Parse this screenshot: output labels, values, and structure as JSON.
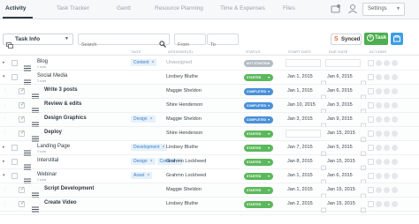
{
  "nav": {
    "tabs": [
      {
        "label": "Activity",
        "active": true
      },
      {
        "label": "Task Tracker"
      },
      {
        "label": "Gantt"
      },
      {
        "label": "Resource Planning"
      },
      {
        "label": "Time & Expenses"
      },
      {
        "label": "Files"
      }
    ],
    "settings_label": "Settings"
  },
  "toolbar": {
    "view_label": "Task Info",
    "search_placeholder": "Search",
    "from_placeholder": "From",
    "to_placeholder": "To",
    "synced_label": "Synced",
    "add_task_label": "Task"
  },
  "columns": {
    "tags": "TAGS",
    "assignee": "ASSIGNEE(S)",
    "status": "STATUS",
    "start_date": "START DATE",
    "due_date": "DUE DATE",
    "actions": "ACTIONS"
  },
  "colors": {
    "not_started": "#b4bcc4",
    "started": "#5cb85c",
    "completed": "#4a90d9",
    "tag_bg": "#e6f1fb",
    "tag_text": "#3b7fc4"
  },
  "rows": [
    {
      "name": "Blog",
      "sub": "2 subs",
      "tags": [
        "Content"
      ],
      "assignee": "Unassigned",
      "status": "NOT STARTED",
      "status_key": "not_started",
      "start": "",
      "due": "",
      "level": 0,
      "expand": "closed"
    },
    {
      "name": "Social Media",
      "sub": "3 subs",
      "tags": [],
      "assignee": "Lindsey Bluthe",
      "status": "STARTED",
      "status_key": "started",
      "start": "Jan 1, 2015",
      "due": "Jan 6, 2015",
      "level": 0,
      "expand": "open"
    },
    {
      "name": "Write 3 posts",
      "sub": "",
      "tags": [],
      "assignee": "Maggie Sheldon",
      "status": "COMPLETED",
      "status_key": "completed",
      "start": "Jan 1, 2015",
      "due": "Jan 6, 2015",
      "level": 1,
      "checked": true
    },
    {
      "name": "Review & edits",
      "sub": "",
      "tags": [],
      "assignee": "Shire Henderson",
      "status": "COMPLETED",
      "status_key": "completed",
      "start": "Jan 10, 2015",
      "due": "Jan 3, 2015",
      "level": 1,
      "checked": true
    },
    {
      "name": "Design Graphics",
      "sub": "",
      "tags": [
        "Design"
      ],
      "assignee": "Maggie Sheldon",
      "status": "COMPLETED",
      "status_key": "completed",
      "start": "Jan 3, 2015",
      "due": "Jan 9, 2015",
      "level": 1,
      "checked": true
    },
    {
      "name": "Deploy",
      "sub": "",
      "tags": [],
      "assignee": "Shire Henderson",
      "status": "STARTED",
      "status_key": "started",
      "start": "",
      "due": "Jan 15, 2015",
      "level": 1,
      "checked": true
    },
    {
      "name": "Landing Page",
      "sub": "3 subs",
      "tags": [
        "Development"
      ],
      "assignee": "Lindsey Bluthe",
      "status": "STARTED",
      "status_key": "started",
      "start": "Jan 7, 2015",
      "due": "Jan 5, 2015",
      "level": 0,
      "expand": "closed"
    },
    {
      "name": "Interstital",
      "sub": "",
      "tags": [
        "Design",
        "Content"
      ],
      "assignee": "Grahmn Lockheed",
      "status": "STARTED",
      "status_key": "started",
      "start": "Jan 8, 2015",
      "due": "Jan 15, 2015",
      "level": 0,
      "expand": "closed"
    },
    {
      "name": "Webinar",
      "sub": "2 subs",
      "tags": [
        "Asset"
      ],
      "assignee": "Grahmn Lockheed",
      "status": "STARTED",
      "status_key": "started",
      "start": "Jan 1, 2015",
      "due": "Jan 6, 2015",
      "level": 0,
      "expand": "open"
    },
    {
      "name": "Script Development",
      "sub": "",
      "tags": [],
      "assignee": "Maggie Sheldon",
      "status": "STARTED",
      "status_key": "started",
      "start": "Jan 1, 2015",
      "due": "Jan 15, 2015",
      "level": 1,
      "checked": true
    },
    {
      "name": "Create Video",
      "sub": "",
      "tags": [],
      "assignee": "Lindsey Bluthe",
      "status": "STARTED",
      "status_key": "started",
      "start": "Jan 2, 2015",
      "due": "Jan 15, 2015",
      "level": 1,
      "checked": true
    }
  ]
}
